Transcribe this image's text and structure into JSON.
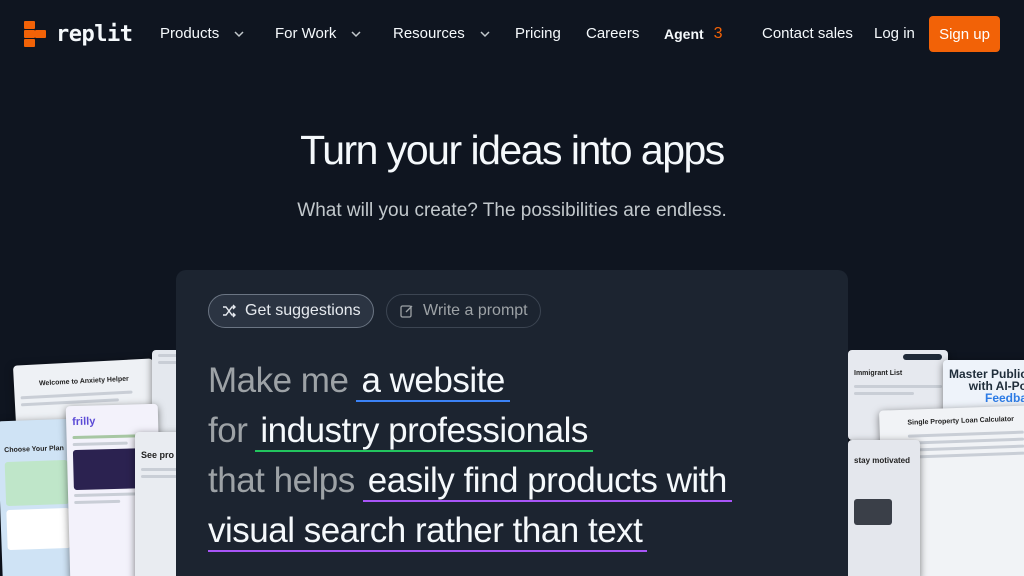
{
  "nav": {
    "logo_text": "replit",
    "products": "Products",
    "for_work": "For Work",
    "resources": "Resources",
    "pricing": "Pricing",
    "careers": "Careers",
    "agent": "Agent",
    "agent_version": "3",
    "contact_sales": "Contact sales",
    "log_in": "Log in",
    "sign_up": "Sign up"
  },
  "hero": {
    "title": "Turn your ideas into apps",
    "subtitle": "What will you create? The possibilities are endless."
  },
  "card": {
    "chip_suggestions": "Get suggestions",
    "chip_write": "Write a prompt",
    "line1_prefix": "Make me",
    "line1_fill": "a website",
    "line2_prefix": "for",
    "line2_fill": "industry professionals",
    "line3_prefix": "that helps",
    "line3_fill": "easily find products with",
    "line4_fill": "visual search rather than text"
  },
  "previews": {
    "left_1": "Welcome to Anxiety Helper",
    "left_2": "frilly",
    "left_3": "Choose Your Plan",
    "left_4": "See pro",
    "right_1": "Immigrant List",
    "right_2": "Single Property Loan Calculator",
    "right_3": "stay motivated",
    "right_banner_line1": "Master Public",
    "right_banner_line2": "with AI-Po",
    "right_banner_line3": "Feedba"
  },
  "colors": {
    "background": "#0f1520",
    "accent": "#f26207",
    "card": "#1c2430",
    "underline_blue": "#3b82f6",
    "underline_green": "#22c55e",
    "underline_purple": "#a855f7"
  }
}
